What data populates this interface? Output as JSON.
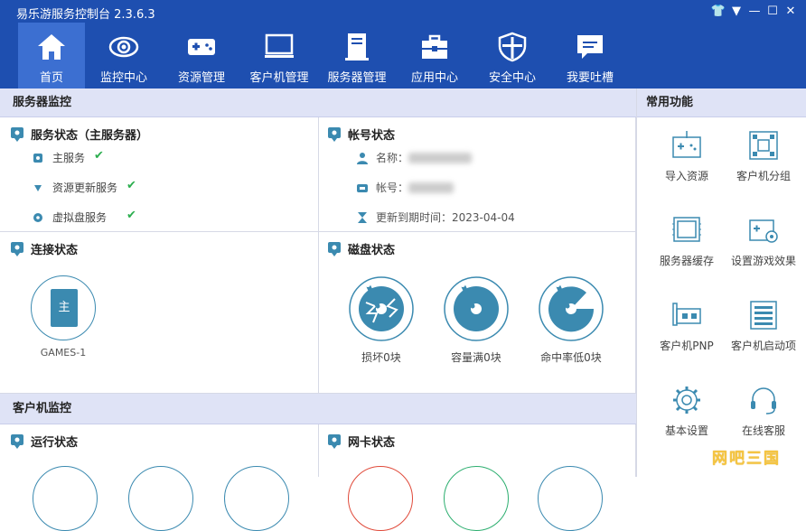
{
  "app": {
    "title": "易乐游服务控制台 2.3.6.3"
  },
  "window_controls": [
    "shirt-icon",
    "dropdown-icon",
    "minimize-icon",
    "maximize-icon",
    "close-icon"
  ],
  "nav": [
    {
      "label": "首页",
      "icon": "home-icon",
      "active": true
    },
    {
      "label": "监控中心",
      "icon": "eye-icon"
    },
    {
      "label": "资源管理",
      "icon": "gamepad-icon"
    },
    {
      "label": "客户机管理",
      "icon": "monitor-icon"
    },
    {
      "label": "服务器管理",
      "icon": "server-icon"
    },
    {
      "label": "应用中心",
      "icon": "toolbox-icon"
    },
    {
      "label": "安全中心",
      "icon": "shield-icon"
    },
    {
      "label": "我要吐槽",
      "icon": "chat-icon"
    }
  ],
  "server_monitor": {
    "title": "服务器监控",
    "service_status": {
      "title": "服务状态（主服务器）",
      "items": [
        {
          "label": "主服务",
          "status": "✔"
        },
        {
          "label": "资源更新服务",
          "status": "✔"
        },
        {
          "label": "虚拟盘服务",
          "status": "✔"
        }
      ]
    },
    "account_status": {
      "title": "帐号状态",
      "name_label": "名称：",
      "account_label": "帐号：",
      "expiry_label": "更新到期时间：",
      "expiry_value": "2023-04-04"
    },
    "connection_status": {
      "title": "连接状态",
      "server_glyph": "主",
      "server_name": "GAMES-1"
    },
    "disk_status": {
      "title": "磁盘状态",
      "items": [
        "损坏0块",
        "容量满0块",
        "命中率低0块"
      ]
    }
  },
  "client_monitor": {
    "title": "客户机监控",
    "run_status": {
      "title": "运行状态"
    },
    "nic_status": {
      "title": "网卡状态"
    }
  },
  "common_functions": {
    "title": "常用功能",
    "items": [
      {
        "label": "导入资源",
        "icon": "import-icon"
      },
      {
        "label": "客户机分组",
        "icon": "group-icon"
      },
      {
        "label": "服务器缓存",
        "icon": "memory-icon"
      },
      {
        "label": "设置游戏效果",
        "icon": "game-settings-icon"
      },
      {
        "label": "客户机PNP",
        "icon": "pnp-icon"
      },
      {
        "label": "客户机启动项",
        "icon": "startup-list-icon"
      },
      {
        "label": "基本设置",
        "icon": "gear-icon"
      },
      {
        "label": "在线客服",
        "icon": "headset-icon"
      }
    ]
  },
  "watermark": "网吧三国",
  "colors": {
    "header": "#1e4fb0",
    "nav_active": "#3c6fd1",
    "section_bar": "#dfe3f6",
    "accent": "#3b8ab0",
    "ok": "#2cae4f"
  }
}
